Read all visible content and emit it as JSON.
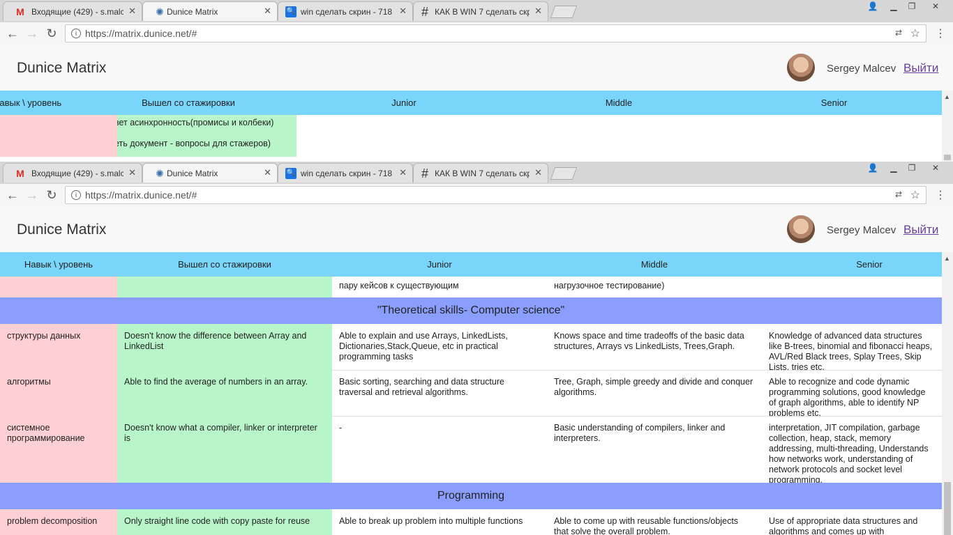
{
  "tabs": [
    {
      "icon": "gmail-icon",
      "glyph": "M",
      "label": "Входящие (429) - s.malce",
      "active": false
    },
    {
      "icon": "react-icon",
      "glyph": "✺",
      "label": "Dunice Matrix",
      "active": true
    },
    {
      "icon": "search-favicon-icon",
      "glyph": "🔍",
      "label": "win сделать скрин - 718",
      "active": false
    },
    {
      "icon": "hash-icon",
      "glyph": "#",
      "label": "КАК В WIN 7 сделать скр",
      "active": false
    }
  ],
  "address": {
    "url": "https://matrix.dunice.net/#"
  },
  "app": {
    "title": "Dunice Matrix",
    "user_name": "Sergey Malcev",
    "logout_label": "Выйти"
  },
  "columns": [
    "Навык \\ уровень",
    "Вышел со стажировки",
    "Junior",
    "Middle",
    "Senior"
  ],
  "top_window": {
    "partial_rows": [
      "вет асинхронность(промисы и колбеки)",
      "еть документ - вопросы для стажеров)"
    ]
  },
  "bottom_window": {
    "cut_row": {
      "junior": "пару кейсов к существующим",
      "middle": "нагрузочное тестирование)"
    },
    "sections": [
      {
        "title": "\"Theoretical skills- Computer science\"",
        "rows": [
          {
            "skill": "структуры данных",
            "intern": "Doesn't know the difference between Array and LinkedList",
            "junior": "Able to explain and use Arrays, LinkedLists, Dictionaries,Stack,Queue, etc in practical programming tasks",
            "middle": "Knows space and time tradeoffs of the basic data structures, Arrays vs LinkedLists, Trees,Graph.",
            "senior": "Knowledge of advanced data structures like B-trees, binomial and fibonacci heaps, AVL/Red Black trees, Splay Trees, Skip Lists, tries etc."
          },
          {
            "skill": "алгоритмы",
            "intern": "Able to find the average of numbers in an array.",
            "junior": "Basic sorting, searching and data structure traversal and retrieval algorithms.",
            "middle": "Tree, Graph, simple greedy and divide and conquer algorithms.",
            "senior": "Able to recognize and code dynamic programming solutions, good knowledge of graph algorithms, able to identify NP problems etc."
          },
          {
            "skill": "системное программирование",
            "intern": "Doesn't know what a compiler, linker or interpreter is",
            "junior": "-",
            "middle": "Basic understanding of compilers, linker and interpreters.",
            "senior": " interpretation, JIT compilation, garbage collection, heap, stack, memory addressing, multi-threading, Understands how networks work, understanding of network protocols and socket level programming."
          }
        ]
      },
      {
        "title": "Programming",
        "rows": [
          {
            "skill": "problem decomposition",
            "intern": "Only straight line code with copy paste for reuse",
            "junior": "Able to break up problem into multiple functions",
            "middle": "Able to come up with reusable functions/objects that solve the overall problem.",
            "senior": "Use of appropriate data structures and algorithms and comes up with generic/object-oriented code"
          }
        ]
      }
    ]
  }
}
